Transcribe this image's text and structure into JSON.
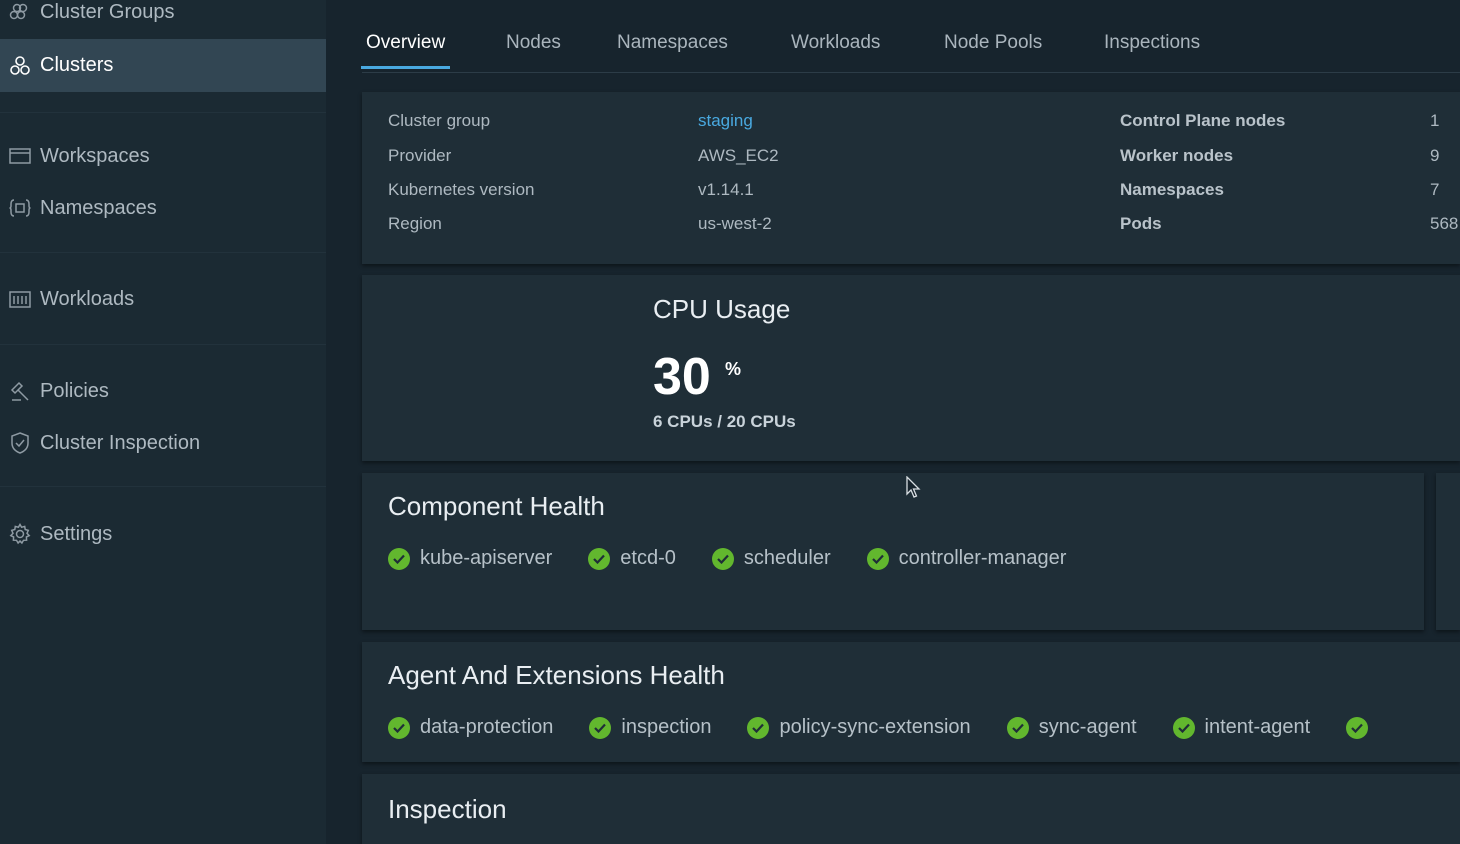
{
  "sidebar": {
    "items": [
      {
        "label": "Cluster Groups",
        "icon": "cluster-groups-icon"
      },
      {
        "label": "Clusters",
        "icon": "clusters-icon",
        "active": true
      },
      {
        "label": "Workspaces",
        "icon": "workspaces-icon"
      },
      {
        "label": "Namespaces",
        "icon": "namespaces-icon"
      },
      {
        "label": "Workloads",
        "icon": "workloads-icon"
      },
      {
        "label": "Policies",
        "icon": "policies-icon"
      },
      {
        "label": "Cluster Inspection",
        "icon": "cluster-inspection-icon"
      },
      {
        "label": "Settings",
        "icon": "settings-icon"
      }
    ]
  },
  "tabs": [
    {
      "label": "Overview",
      "active": true
    },
    {
      "label": "Nodes"
    },
    {
      "label": "Namespaces"
    },
    {
      "label": "Workloads"
    },
    {
      "label": "Node Pools"
    },
    {
      "label": "Inspections"
    }
  ],
  "summary": {
    "left": [
      {
        "label": "Cluster group",
        "value": "staging"
      },
      {
        "label": "Provider",
        "value": "AWS_EC2"
      },
      {
        "label": "Kubernetes version",
        "value": "v1.14.1"
      },
      {
        "label": "Region",
        "value": "us-west-2"
      }
    ],
    "right": [
      {
        "label": "Control Plane nodes",
        "value": "1"
      },
      {
        "label": "Worker nodes",
        "value": "9"
      },
      {
        "label": "Namespaces",
        "value": "7"
      },
      {
        "label": "Pods",
        "value": "568"
      }
    ]
  },
  "cpu": {
    "title": "CPU Usage",
    "value": "30",
    "unit": "%",
    "detail": "6 CPUs / 20 CPUs"
  },
  "component_health": {
    "title": "Component Health",
    "items": [
      "kube-apiserver",
      "etcd-0",
      "scheduler",
      "controller-manager"
    ]
  },
  "agent_health": {
    "title": "Agent And Extensions Health",
    "items": [
      "data-protection",
      "inspection",
      "policy-sync-extension",
      "sync-agent",
      "intent-agent"
    ]
  },
  "inspection": {
    "title": "Inspection"
  },
  "colors": {
    "accent": "#49a9e0",
    "healthy": "#62b72e",
    "background": "#17242d",
    "card": "#1f2e37"
  }
}
